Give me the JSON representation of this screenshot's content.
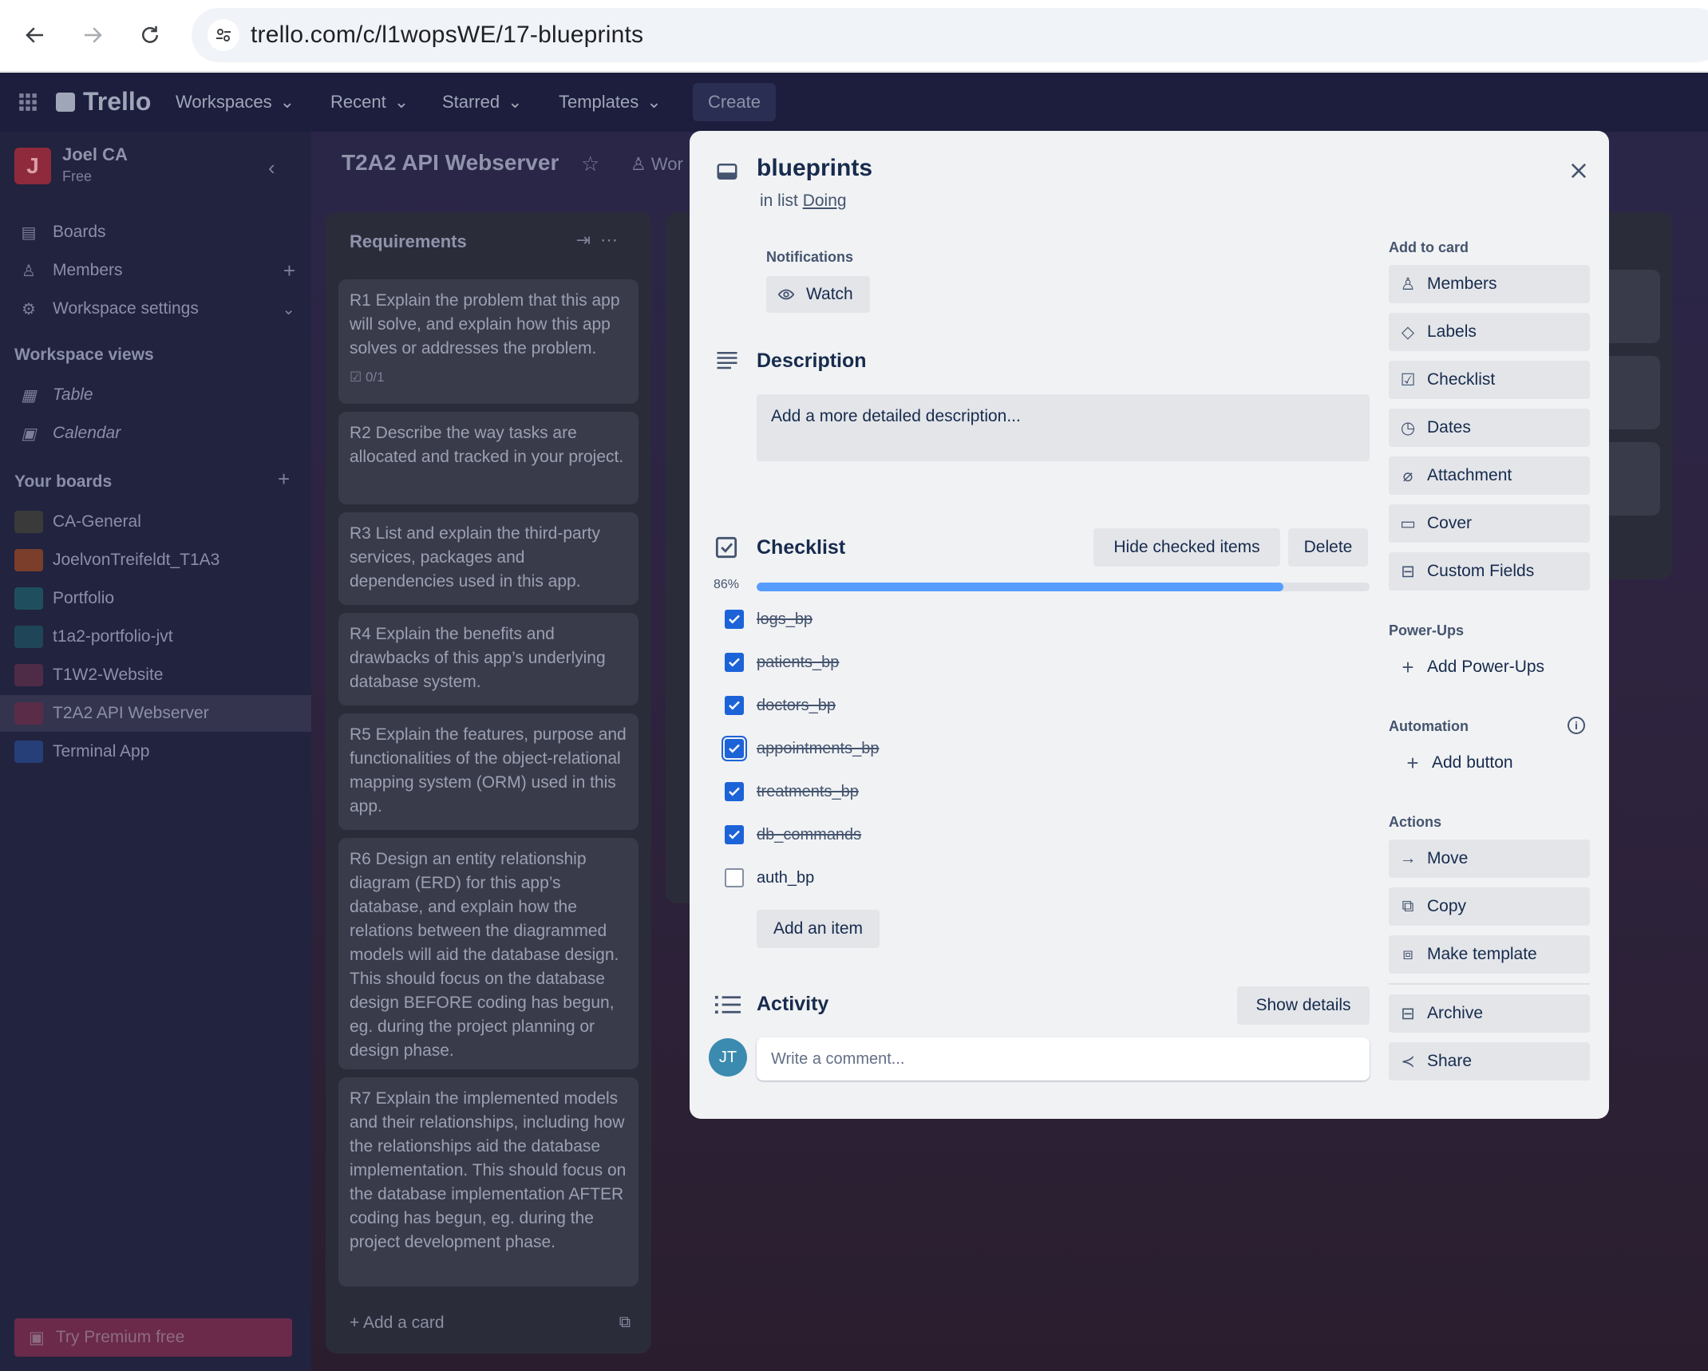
{
  "browser": {
    "url": "trello.com/c/l1wopsWE/17-blueprints"
  },
  "topbar": {
    "logo": "Trello",
    "nav": [
      "Workspaces",
      "Recent",
      "Starred",
      "Templates"
    ],
    "create": "Create"
  },
  "sidebar": {
    "workspace_initial": "J",
    "workspace_name": "Joel CA",
    "workspace_plan": "Free",
    "items": [
      {
        "label": "Boards"
      },
      {
        "label": "Members"
      },
      {
        "label": "Workspace settings"
      }
    ],
    "views_heading": "Workspace views",
    "views": [
      "Table",
      "Calendar"
    ],
    "boards_heading": "Your boards",
    "boards": [
      {
        "label": "CA-General",
        "color": "#3a3a3a"
      },
      {
        "label": "JoelvonTreifeldt_T1A3",
        "color": "#8a4a2c"
      },
      {
        "label": "Portfolio",
        "color": "#1f5060"
      },
      {
        "label": "t1a2-portfolio-jvt",
        "color": "#1f4a5a"
      },
      {
        "label": "T1W2-Website",
        "color": "#5a3050"
      },
      {
        "label": "T2A2 API Webserver",
        "color": "#6a3050"
      },
      {
        "label": "Terminal App",
        "color": "#2a4a8a"
      }
    ],
    "premium": "Try Premium free"
  },
  "board": {
    "title": "T2A2 API Webserver",
    "visibility": "Wor"
  },
  "list": {
    "title": "Requirements",
    "cards": [
      "R1 Explain the problem that this app will solve, and explain how this app solves or addresses the problem.",
      "R2 Describe the way tasks are allocated and tracked in your project.",
      "R3 List and explain the third-party services, packages and dependencies used in this app.",
      "R4 Explain the benefits and drawbacks of this app’s underlying database system.",
      "R5 Explain the features, purpose and functionalities of the object-relational mapping system (ORM) used in this app.",
      "R6 Design an entity relationship diagram (ERD) for this app’s database, and explain how the relations between the diagrammed models will aid the database design. This should focus on the database design BEFORE coding has begun, eg. during the project planning or design phase.",
      "R7 Explain the implemented models and their relationships, including how the relationships aid the database implementation. This should focus on the database implementation AFTER coding has begun, eg. during the project development phase."
    ],
    "card1_badge": "0/1",
    "add_card": "Add a card"
  },
  "modal": {
    "title": "blueprints",
    "in_list_prefix": "in list",
    "list_name": "Doing",
    "notifications_label": "Notifications",
    "watch": "Watch",
    "description_title": "Description",
    "description_placeholder": "Add a more detailed description...",
    "checklist_title": "Checklist",
    "hide_checked": "Hide checked items",
    "delete": "Delete",
    "progress_label": "86%",
    "progress": 0.86,
    "items": [
      {
        "label": "logs_bp",
        "checked": true
      },
      {
        "label": "patients_bp",
        "checked": true
      },
      {
        "label": "doctors_bp",
        "checked": true
      },
      {
        "label": "appointments_bp",
        "checked": true
      },
      {
        "label": "treatments_bp",
        "checked": true
      },
      {
        "label": "db_commands",
        "checked": true
      },
      {
        "label": "auth_bp",
        "checked": false
      }
    ],
    "add_item": "Add an item",
    "activity_title": "Activity",
    "show_details": "Show details",
    "avatar_initials": "JT",
    "comment_placeholder": "Write a comment..."
  },
  "side": {
    "add_to_card_heading": "Add to card",
    "add_to_card": [
      "Members",
      "Labels",
      "Checklist",
      "Dates",
      "Attachment",
      "Cover",
      "Custom Fields"
    ],
    "powerups_heading": "Power-Ups",
    "add_powerups": "Add Power-Ups",
    "automation_heading": "Automation",
    "add_button": "Add button",
    "actions_heading": "Actions",
    "actions": [
      "Move",
      "Copy",
      "Make template"
    ],
    "archive": "Archive",
    "share": "Share"
  }
}
